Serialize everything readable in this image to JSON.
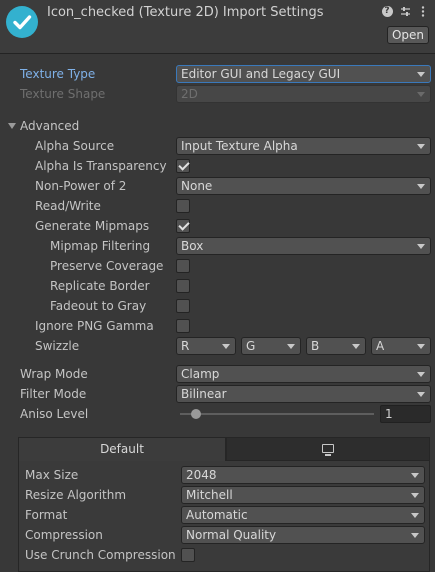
{
  "header": {
    "title": "Icon_checked (Texture 2D) Import Settings",
    "open_label": "Open"
  },
  "texture_type": {
    "label": "Texture Type",
    "value": "Editor GUI and Legacy GUI"
  },
  "texture_shape": {
    "label": "Texture Shape",
    "value": "2D"
  },
  "advanced": {
    "label": "Advanced",
    "alpha_source": {
      "label": "Alpha Source",
      "value": "Input Texture Alpha"
    },
    "alpha_is_transparency": {
      "label": "Alpha Is Transparency",
      "checked": true
    },
    "non_power_of_2": {
      "label": "Non-Power of 2",
      "value": "None"
    },
    "read_write": {
      "label": "Read/Write",
      "checked": false
    },
    "generate_mipmaps": {
      "label": "Generate Mipmaps",
      "checked": true
    },
    "mipmap_filtering": {
      "label": "Mipmap Filtering",
      "value": "Box"
    },
    "preserve_coverage": {
      "label": "Preserve Coverage",
      "checked": false
    },
    "replicate_border": {
      "label": "Replicate Border",
      "checked": false
    },
    "fadeout_to_gray": {
      "label": "Fadeout to Gray",
      "checked": false
    },
    "ignore_png_gamma": {
      "label": "Ignore PNG Gamma",
      "checked": false
    },
    "swizzle": {
      "label": "Swizzle",
      "values": [
        "R",
        "G",
        "B",
        "A"
      ]
    }
  },
  "wrap_mode": {
    "label": "Wrap Mode",
    "value": "Clamp"
  },
  "filter_mode": {
    "label": "Filter Mode",
    "value": "Bilinear"
  },
  "aniso_level": {
    "label": "Aniso Level",
    "value": "1",
    "level": 1,
    "range": [
      0,
      16
    ]
  },
  "platform": {
    "tabs": [
      {
        "label": "Default",
        "active": true
      },
      {
        "icon": "monitor-icon",
        "active": false
      }
    ],
    "max_size": {
      "label": "Max Size",
      "value": "2048"
    },
    "resize_algorithm": {
      "label": "Resize Algorithm",
      "value": "Mitchell"
    },
    "format": {
      "label": "Format",
      "value": "Automatic"
    },
    "compression": {
      "label": "Compression",
      "value": "Normal Quality"
    },
    "use_crunch": {
      "label": "Use Crunch Compression",
      "checked": false
    }
  },
  "colors": {
    "accent": "#3a79bb",
    "icon_bg": "#33b1cf",
    "panel_bg": "#383838"
  }
}
